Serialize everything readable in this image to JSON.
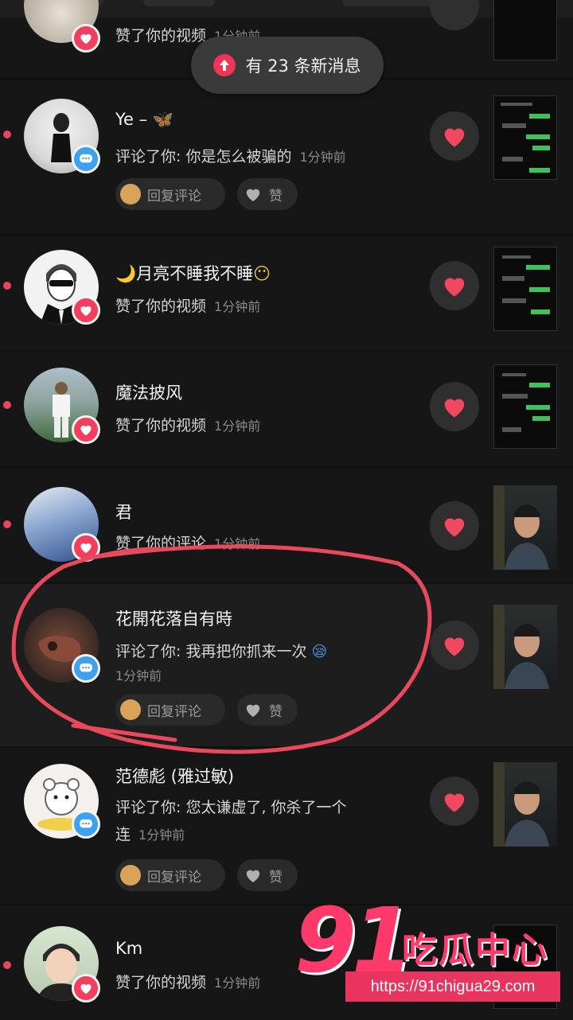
{
  "toast": {
    "text": "有 23 条新消息"
  },
  "notifications": [
    {
      "name": "",
      "action": "赞了你的视频",
      "time": "1分钟前"
    },
    {
      "name": "Ye –",
      "action": "评论了你: 你是怎么被骗的",
      "time": "1分钟前",
      "reply_label": "回复评论",
      "like_label": "赞"
    },
    {
      "name": "月亮不睡我不睡",
      "action": "赞了你的视频",
      "time": "1分钟前"
    },
    {
      "name": "魔法披风",
      "action": "赞了你的视频",
      "time": "1分钟前"
    },
    {
      "name": "君",
      "action": "赞了你的评论",
      "time": "1分钟前"
    },
    {
      "name": "花開花落自有時",
      "action": "评论了你: 我再把你抓来一次",
      "time": "1分钟前",
      "reply_label": "回复评论",
      "like_label": "赞"
    },
    {
      "name": "范德彪 (雅过敏)",
      "action": "评论了你: 您太谦虚了, 你杀了一个",
      "action_line2": "连",
      "time": "1分钟前",
      "reply_label": "回复评论",
      "like_label": "赞"
    },
    {
      "name": "Km",
      "action": "赞了你的视频",
      "time": "1分钟前"
    }
  ],
  "watermark": {
    "logo": "91",
    "name": "吃瓜中心",
    "url": "https://91chigua29.com"
  },
  "colors": {
    "background": "#161616",
    "accent": "#f33e5e",
    "comment_badge": "#3ea0f0",
    "highlight_circle": "#e84a5c"
  }
}
